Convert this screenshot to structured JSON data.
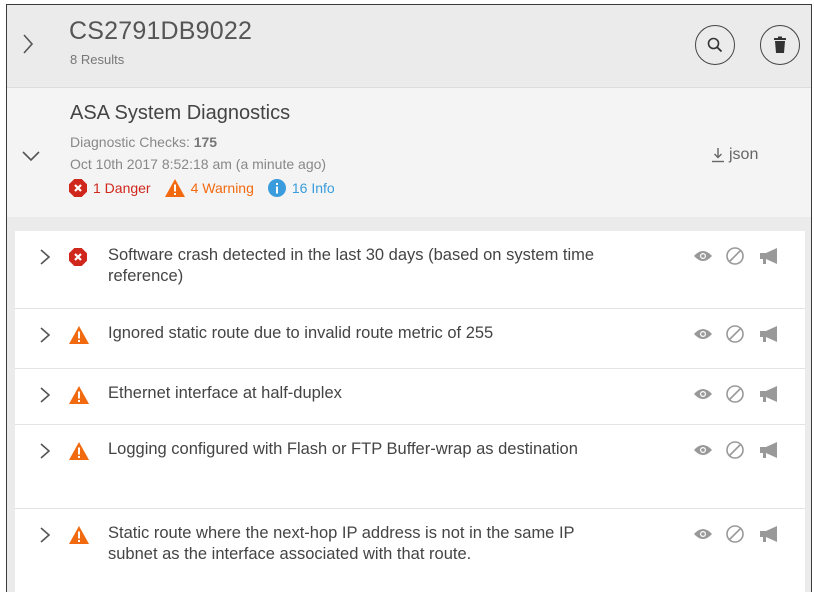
{
  "header": {
    "title": "CS2791DB9022",
    "subtitle": "8 Results",
    "expand_icon": "chevron-right-icon",
    "search_icon": "search-icon",
    "trash_icon": "trash-icon"
  },
  "summary": {
    "title": "ASA System Diagnostics",
    "checks_label": "Diagnostic Checks: ",
    "checks_value": "175",
    "date": "Oct 10th 2017 8:52:18 am (a minute ago)",
    "collapse_icon": "chevron-down-icon",
    "badges": {
      "danger": "1 Danger",
      "warning": "4 Warning",
      "info": "16 Info"
    },
    "json_label": "json"
  },
  "colors": {
    "danger": "#d0271d",
    "warning": "#f26a10",
    "info": "#3a9cdc",
    "header_bg": "#ebebeb"
  },
  "rows": [
    {
      "severity": "danger",
      "text": "Software crash detected in the last 30 days (based on system time reference)"
    },
    {
      "severity": "warning",
      "text": "Ignored static route due to invalid route metric of 255"
    },
    {
      "severity": "warning",
      "text": "Ethernet interface at half-duplex"
    },
    {
      "severity": "warning",
      "text": "Logging configured with Flash or FTP Buffer-wrap as destination"
    },
    {
      "severity": "warning",
      "text": "Static route where the next-hop IP address is not in the same IP subnet as the interface associated with that route."
    }
  ],
  "row_actions": [
    "eye-icon",
    "ignore-icon",
    "megaphone-icon"
  ]
}
